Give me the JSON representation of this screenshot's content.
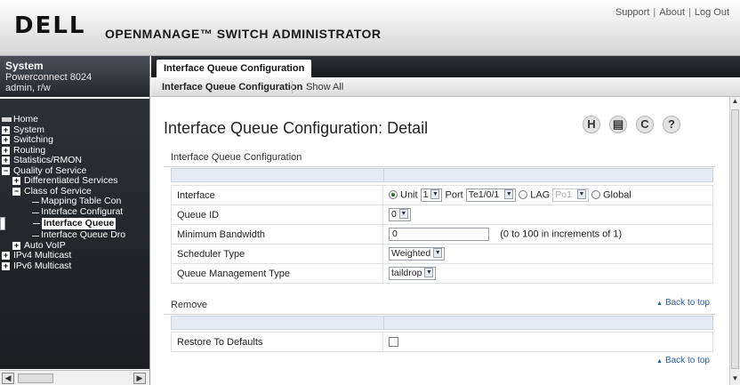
{
  "header": {
    "logo": "DELL",
    "product": "OPENMANAGE™ SWITCH ADMINISTRATOR",
    "links": [
      "Support",
      "About",
      "Log Out"
    ],
    "link_separator": "|"
  },
  "system_box": {
    "title": "System",
    "model": "Powerconnect 8024",
    "user": "admin, r/w"
  },
  "tree": [
    {
      "label": "Home",
      "level": 0,
      "icon": "home-icon"
    },
    {
      "label": "System",
      "level": 0,
      "icon": "expand-icon"
    },
    {
      "label": "Switching",
      "level": 0,
      "icon": "expand-icon"
    },
    {
      "label": "Routing",
      "level": 0,
      "icon": "expand-icon"
    },
    {
      "label": "Statistics/RMON",
      "level": 0,
      "icon": "expand-icon"
    },
    {
      "label": "Quality of Service",
      "level": 0,
      "icon": "collapse-icon"
    },
    {
      "label": "Differentiated Services",
      "level": 1,
      "icon": "expand-icon"
    },
    {
      "label": "Class of Service",
      "level": 1,
      "icon": "collapse-icon"
    },
    {
      "label": "Mapping Table Con",
      "level": 2,
      "icon": ""
    },
    {
      "label": "Interface Configurat",
      "level": 2,
      "icon": ""
    },
    {
      "label": "Interface Queue",
      "level": 2,
      "icon": "",
      "selected": true
    },
    {
      "label": "Interface Queue Dro",
      "level": 2,
      "icon": ""
    },
    {
      "label": "Auto VoIP",
      "level": 1,
      "icon": "expand-icon"
    },
    {
      "label": "IPv4 Multicast",
      "level": 0,
      "icon": "expand-icon"
    },
    {
      "label": "IPv6 Multicast",
      "level": 0,
      "icon": "expand-icon"
    }
  ],
  "tabs": {
    "main_tab": "Interface Queue Configuration",
    "sub_active": "Interface Queue Configuration",
    "sub_other": "Show All"
  },
  "page": {
    "title": "Interface Queue Configuration: Detail",
    "toolbar": {
      "save": "H",
      "print": "▤",
      "refresh": "C",
      "help": "?"
    }
  },
  "config_section": {
    "label": "Interface Queue Configuration",
    "rows": {
      "interface": {
        "label": "Interface",
        "unit_label": "Unit",
        "unit_value": "1",
        "port_label": "Port",
        "port_value": "Te1/0/1",
        "lag_label": "LAG",
        "lag_value": "Po1",
        "global_label": "Global"
      },
      "queue_id": {
        "label": "Queue ID",
        "value": "0"
      },
      "min_bandwidth": {
        "label": "Minimum Bandwidth",
        "value": "0",
        "hint": "(0 to 100 in increments of 1)"
      },
      "scheduler": {
        "label": "Scheduler Type",
        "value": "Weighted"
      },
      "queue_mgmt": {
        "label": "Queue Management Type",
        "value": "taildrop"
      }
    }
  },
  "remove_section": {
    "label": "Remove",
    "back_to_top": "Back to top",
    "restore_label": "Restore To Defaults",
    "back_to_top_2": "Back to top"
  }
}
